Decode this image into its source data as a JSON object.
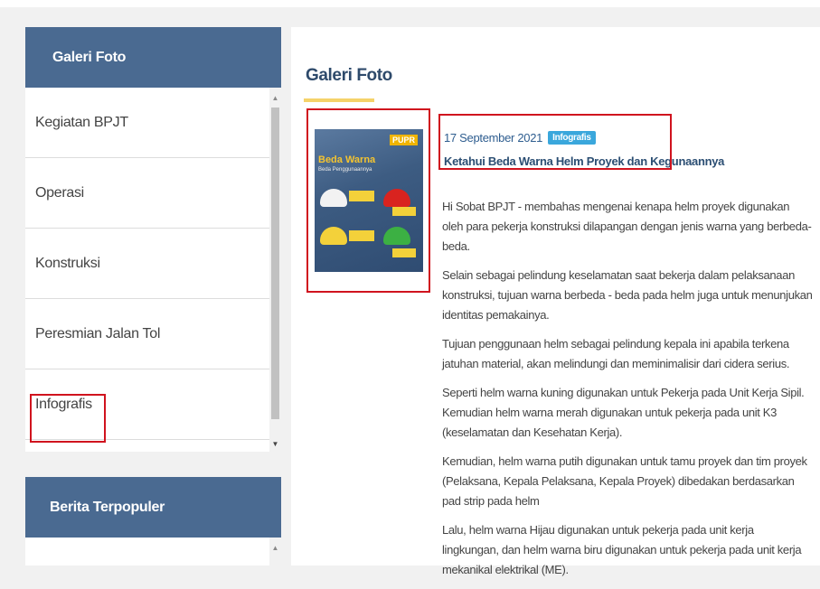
{
  "sidebar": {
    "title": "Galeri Foto",
    "items": [
      {
        "label": "Kegiatan BPJT"
      },
      {
        "label": "Operasi"
      },
      {
        "label": "Konstruksi"
      },
      {
        "label": "Peresmian Jalan Tol"
      },
      {
        "label": "Infografis"
      }
    ]
  },
  "sidebar2": {
    "title": "Berita Terpopuler"
  },
  "main": {
    "title": "Galeri Foto",
    "article": {
      "date": "17 September 2021",
      "category": "Infografis",
      "headline": "Ketahui Beda Warna Helm Proyek dan Kegunaannya",
      "thumbnail": {
        "logo": "PUPR",
        "title": "Beda Warna",
        "subtitle": "Beda Penggunaannya"
      },
      "paragraphs": [
        "Hi Sobat BPJT - membahas mengenai kenapa helm proyek digunakan oleh para pekerja konstruksi dilapangan dengan jenis warna yang berbeda-beda.",
        "Selain sebagai pelindung keselamatan saat bekerja dalam pelaksanaan konstruksi, tujuan warna berbeda - beda pada helm juga untuk menunjukan identitas pemakainya.",
        "Tujuan penggunaan helm sebagai pelindung kepala ini apabila terkena jatuhan material, akan melindungi dan meminimalisir dari cidera serius.",
        "Seperti helm warna kuning digunakan untuk Pekerja pada Unit Kerja Sipil. Kemudian helm warna merah digunakan untuk pekerja pada unit K3 (keselamatan dan Kesehatan Kerja).",
        "Kemudian, helm warna putih digunakan untuk tamu proyek dan tim proyek (Pelaksana, Kepala Pelaksana, Kepala Proyek) dibedakan berdasarkan pad strip pada helm",
        "Lalu, helm warna Hijau digunakan untuk pekerja pada unit kerja lingkungan, dan helm warna biru digunakan untuk pekerja pada unit kerja mekanikal elektrikal (ME)."
      ]
    }
  },
  "colors": {
    "sidebar_header": "#4a6a91",
    "highlight": "#d0131e",
    "badge": "#3aa7dc",
    "underline": "#f5d36a"
  }
}
